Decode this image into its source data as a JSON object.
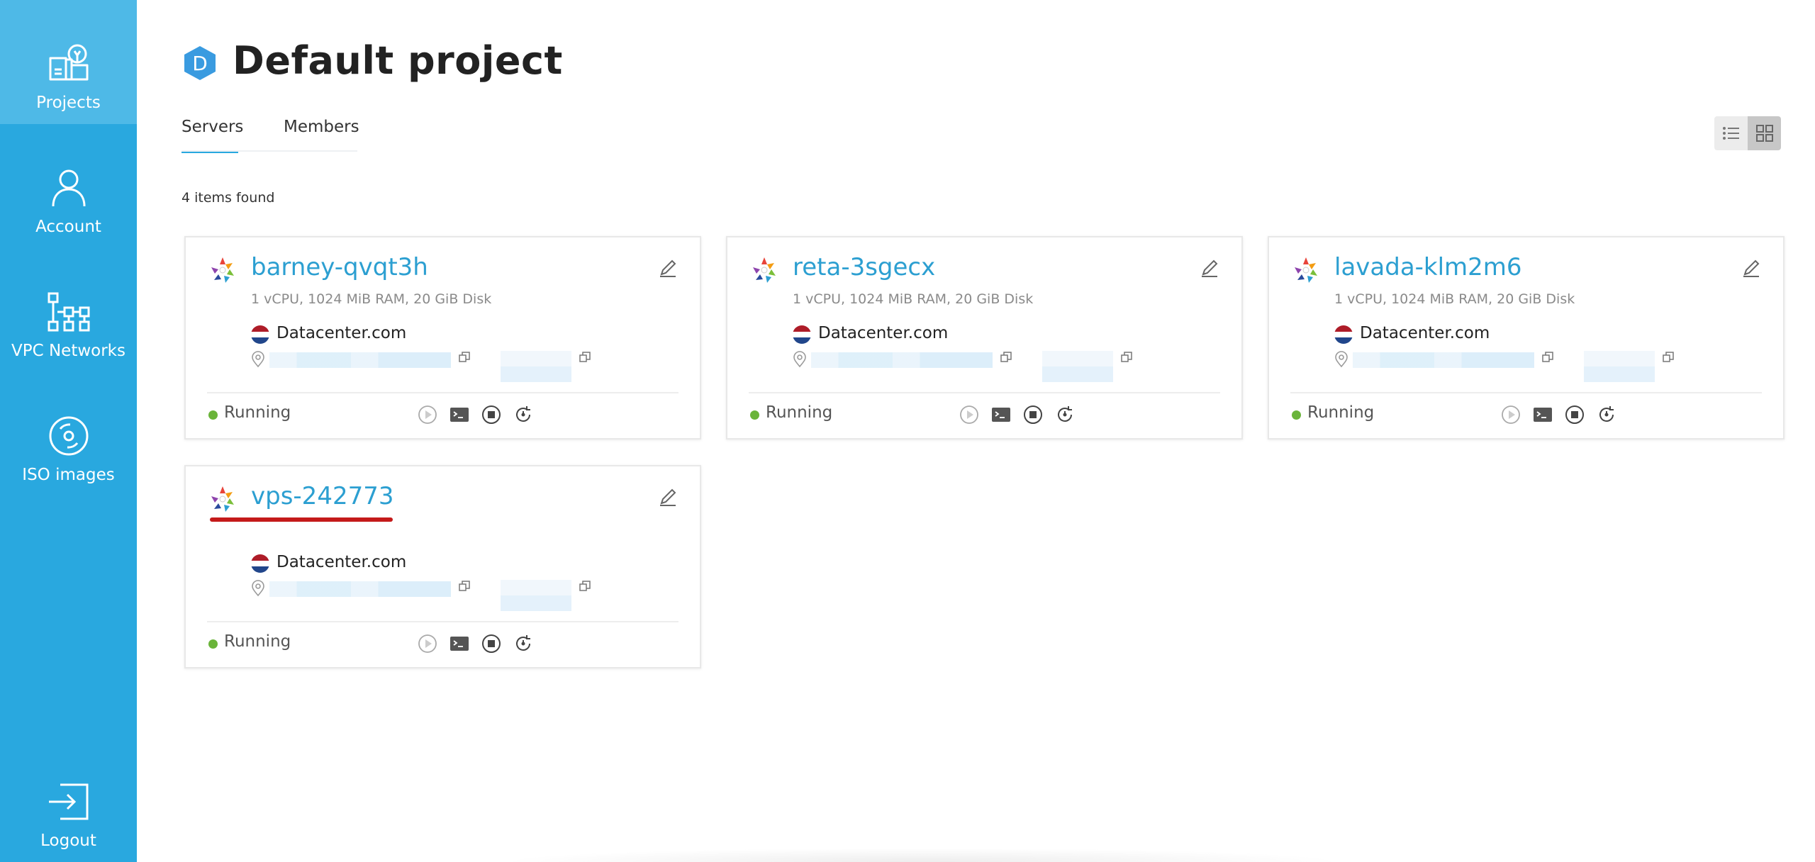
{
  "sidebar": {
    "items": [
      {
        "label": "Projects",
        "icon": "projects-icon"
      },
      {
        "label": "Account",
        "icon": "account-icon"
      },
      {
        "label": "VPC Networks",
        "icon": "vpc-networks-icon"
      },
      {
        "label": "ISO images",
        "icon": "iso-images-icon"
      }
    ],
    "logout": {
      "label": "Logout",
      "icon": "logout-icon"
    }
  },
  "header": {
    "badge_letter": "D",
    "title": "Default project"
  },
  "tabs": [
    {
      "label": "Servers",
      "active": true
    },
    {
      "label": "Members",
      "active": false
    }
  ],
  "view_toggle": {
    "selected": "grid"
  },
  "items_count_text": "4 items found",
  "servers": [
    {
      "name": "barney-qvqt3h",
      "specs": "1 vCPU, 1024 MiB RAM, 20 GiB Disk",
      "datacenter": "Datacenter.com",
      "status": "Running"
    },
    {
      "name": "reta-3sgecx",
      "specs": "1 vCPU, 1024 MiB RAM, 20 GiB Disk",
      "datacenter": "Datacenter.com",
      "status": "Running"
    },
    {
      "name": "lavada-klm2m6",
      "specs": "1 vCPU, 1024 MiB RAM, 20 GiB Disk",
      "datacenter": "Datacenter.com",
      "status": "Running"
    },
    {
      "name": "vps-242773",
      "specs": "",
      "datacenter": "Datacenter.com",
      "status": "Running"
    }
  ],
  "colors": {
    "sidebar": "#29a8df",
    "sidebar_active": "#4eb9e7",
    "link": "#2c9fd1",
    "running": "#6ab43a",
    "highlight_underline": "#c41a1a"
  }
}
